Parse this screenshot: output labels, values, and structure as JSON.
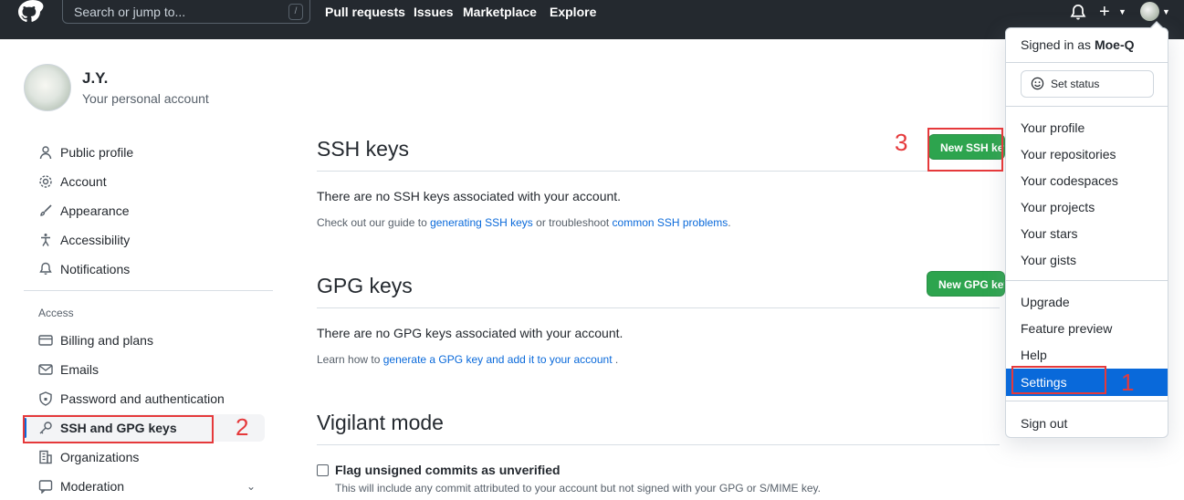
{
  "header": {
    "search_placeholder": "Search or jump to...",
    "search_shortcut": "/",
    "nav": [
      "Pull requests",
      "Issues",
      "Marketplace",
      "Explore"
    ],
    "plus_label": "+"
  },
  "profile": {
    "name": "J.Y.",
    "subtitle": "Your personal account"
  },
  "sidebar": {
    "items": [
      {
        "label": "Public profile",
        "icon": "person-icon"
      },
      {
        "label": "Account",
        "icon": "gear-icon"
      },
      {
        "label": "Appearance",
        "icon": "paintbrush-icon"
      },
      {
        "label": "Accessibility",
        "icon": "accessibility-icon"
      },
      {
        "label": "Notifications",
        "icon": "bell-icon"
      }
    ],
    "section_label": "Access",
    "access_items": [
      {
        "label": "Billing and plans",
        "icon": "credit-card-icon"
      },
      {
        "label": "Emails",
        "icon": "mail-icon"
      },
      {
        "label": "Password and authentication",
        "icon": "shield-lock-icon"
      },
      {
        "label": "SSH and GPG keys",
        "icon": "key-icon"
      },
      {
        "label": "Organizations",
        "icon": "organization-icon"
      },
      {
        "label": "Moderation",
        "icon": "report-icon"
      }
    ]
  },
  "main": {
    "ssh": {
      "title": "SSH keys",
      "button": "New SSH key",
      "empty": "There are no SSH keys associated with your account.",
      "help_prefix": "Check out our guide to ",
      "help_link1": "generating SSH keys",
      "help_middle": " or troubleshoot ",
      "help_link2": "common SSH problems",
      "help_suffix": "."
    },
    "gpg": {
      "title": "GPG keys",
      "button": "New GPG key",
      "empty": "There are no GPG keys associated with your account.",
      "help_prefix": "Learn how to ",
      "help_link": "generate a GPG key and add it to your account",
      "help_suffix": " ."
    },
    "vigilant": {
      "title": "Vigilant mode",
      "checkbox_label": "Flag unsigned commits as unverified",
      "note": "This will include any commit attributed to your account but not signed with your GPG or S/MIME key."
    }
  },
  "dropdown": {
    "signed_in_prefix": "Signed in as",
    "username": "Moe-Q",
    "set_status": "Set status",
    "group1": [
      "Your profile",
      "Your repositories",
      "Your codespaces",
      "Your projects",
      "Your stars",
      "Your gists"
    ],
    "group2": [
      "Upgrade",
      "Feature preview",
      "Help",
      "Settings"
    ],
    "sign_out": "Sign out"
  },
  "annotations": [
    "1",
    "2",
    "3"
  ],
  "colors": {
    "header_bg": "#24292f",
    "green_button": "#2da44e",
    "link": "#0969da",
    "selected_item": "#0969da",
    "annotation_red": "#e5393b"
  }
}
